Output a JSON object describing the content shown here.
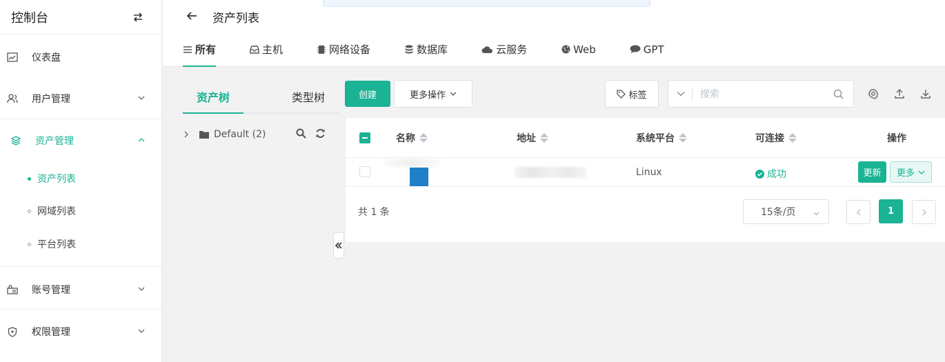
{
  "sidebar": {
    "title": "控制台",
    "items": [
      {
        "label": "仪表盘",
        "icon": "dashboard-icon"
      },
      {
        "label": "用户管理",
        "icon": "users-icon"
      },
      {
        "label": "资产管理",
        "icon": "layers-icon"
      },
      {
        "label": "账号管理",
        "icon": "account-icon"
      },
      {
        "label": "权限管理",
        "icon": "shield-icon"
      }
    ],
    "sub_items": [
      {
        "label": "资产列表"
      },
      {
        "label": "网域列表"
      },
      {
        "label": "平台列表"
      }
    ]
  },
  "header": {
    "title": "资产列表",
    "tabs": [
      {
        "label": "所有",
        "icon": "list-icon"
      },
      {
        "label": "主机",
        "icon": "host-icon"
      },
      {
        "label": "网络设备",
        "icon": "device-icon"
      },
      {
        "label": "数据库",
        "icon": "database-icon"
      },
      {
        "label": "云服务",
        "icon": "cloud-icon"
      },
      {
        "label": "Web",
        "icon": "globe-icon"
      },
      {
        "label": "GPT",
        "icon": "chat-icon"
      }
    ]
  },
  "tree": {
    "tabs": [
      {
        "label": "资产树"
      },
      {
        "label": "类型树"
      }
    ],
    "node_label": "Default (2)"
  },
  "toolbar": {
    "create_label": "创建",
    "more_actions_label": "更多操作",
    "tag_label": "标签",
    "search_placeholder": "搜索"
  },
  "table": {
    "columns": [
      "名称",
      "地址",
      "系统平台",
      "可连接",
      "操作"
    ],
    "rows": [
      {
        "platform": "Linux",
        "status": "成功",
        "update_label": "更新",
        "more_label": "更多"
      }
    ]
  },
  "pagination": {
    "total_text": "共 1 条",
    "page_size": "15条/页",
    "current_page": "1"
  },
  "colors": {
    "accent": "#1ab394",
    "host_icon_block": "#1f7fc7"
  }
}
